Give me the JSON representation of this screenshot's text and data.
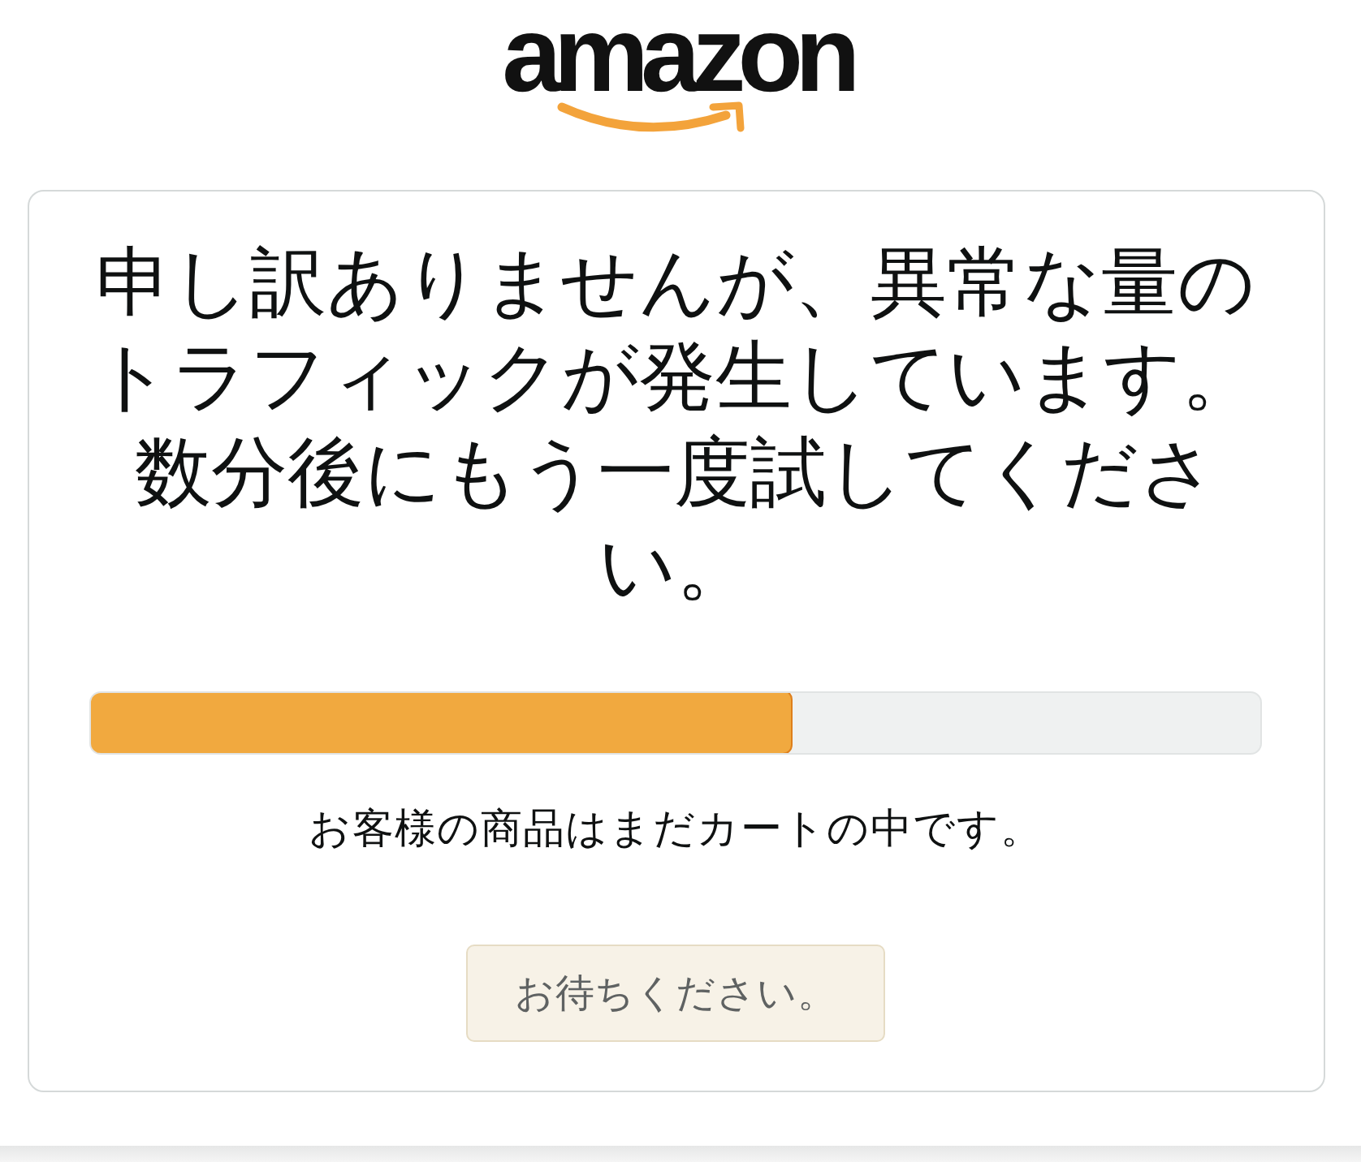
{
  "logo": {
    "text": "amazon"
  },
  "message": {
    "heading": "申し訳ありませんが、異常な量のトラフィックが発生しています。数分後にもう一度試してください。",
    "progress": {
      "level": 0.6
    },
    "note": "お客様の商品はまだカートの中です。",
    "button": {
      "label": "お待ちください。",
      "disabled": true
    }
  }
}
